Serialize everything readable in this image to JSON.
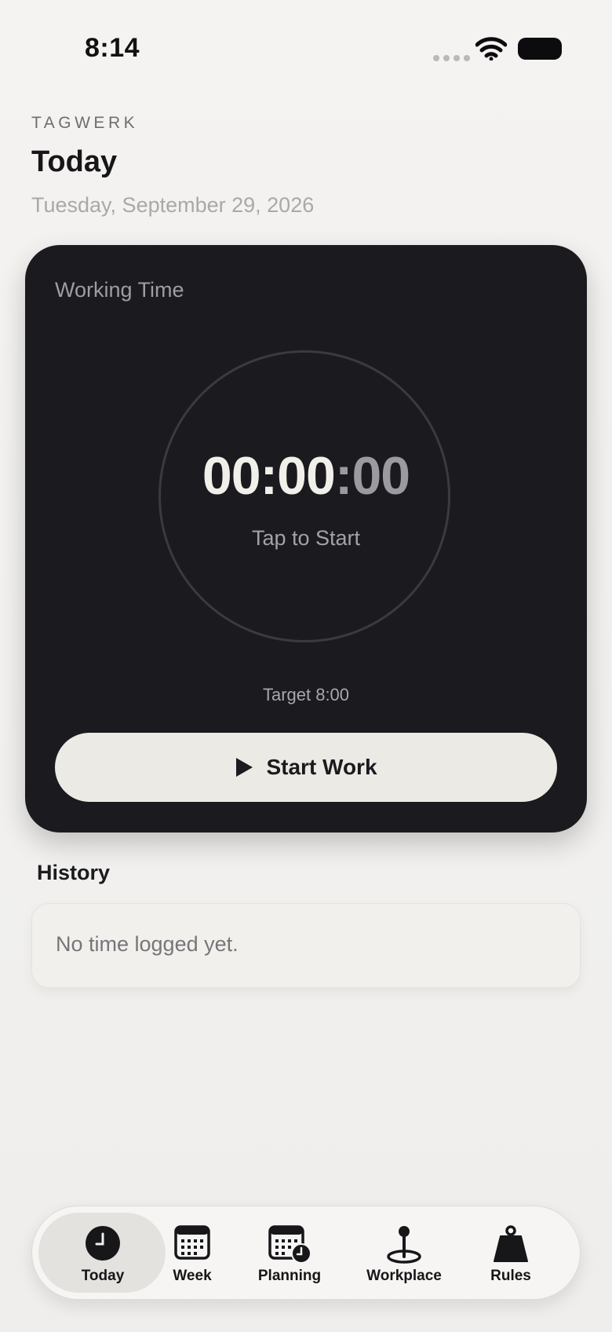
{
  "status": {
    "time": "8:14"
  },
  "header": {
    "app_name": "TAGWERK",
    "title": "Today",
    "date": "Tuesday, September 29, 2026"
  },
  "timer": {
    "label": "Working Time",
    "hours_minutes": "00:00",
    "separator": ":",
    "seconds": "00",
    "hint": "Tap to Start",
    "target": "Target 8:00",
    "start_label": "Start Work"
  },
  "history": {
    "title": "History",
    "empty_text": "No time logged yet."
  },
  "tabs": [
    {
      "label": "Today",
      "icon": "clock-icon",
      "selected": true
    },
    {
      "label": "Week",
      "icon": "calendar-icon",
      "selected": false
    },
    {
      "label": "Planning",
      "icon": "calendar-clock-icon",
      "selected": false
    },
    {
      "label": "Workplace",
      "icon": "map-pin-icon",
      "selected": false
    },
    {
      "label": "Rules",
      "icon": "weight-icon",
      "selected": false
    }
  ],
  "colors": {
    "card_background": "#1b1a1f",
    "button_background": "#eceae4",
    "page_background": "#f2f1ef"
  }
}
